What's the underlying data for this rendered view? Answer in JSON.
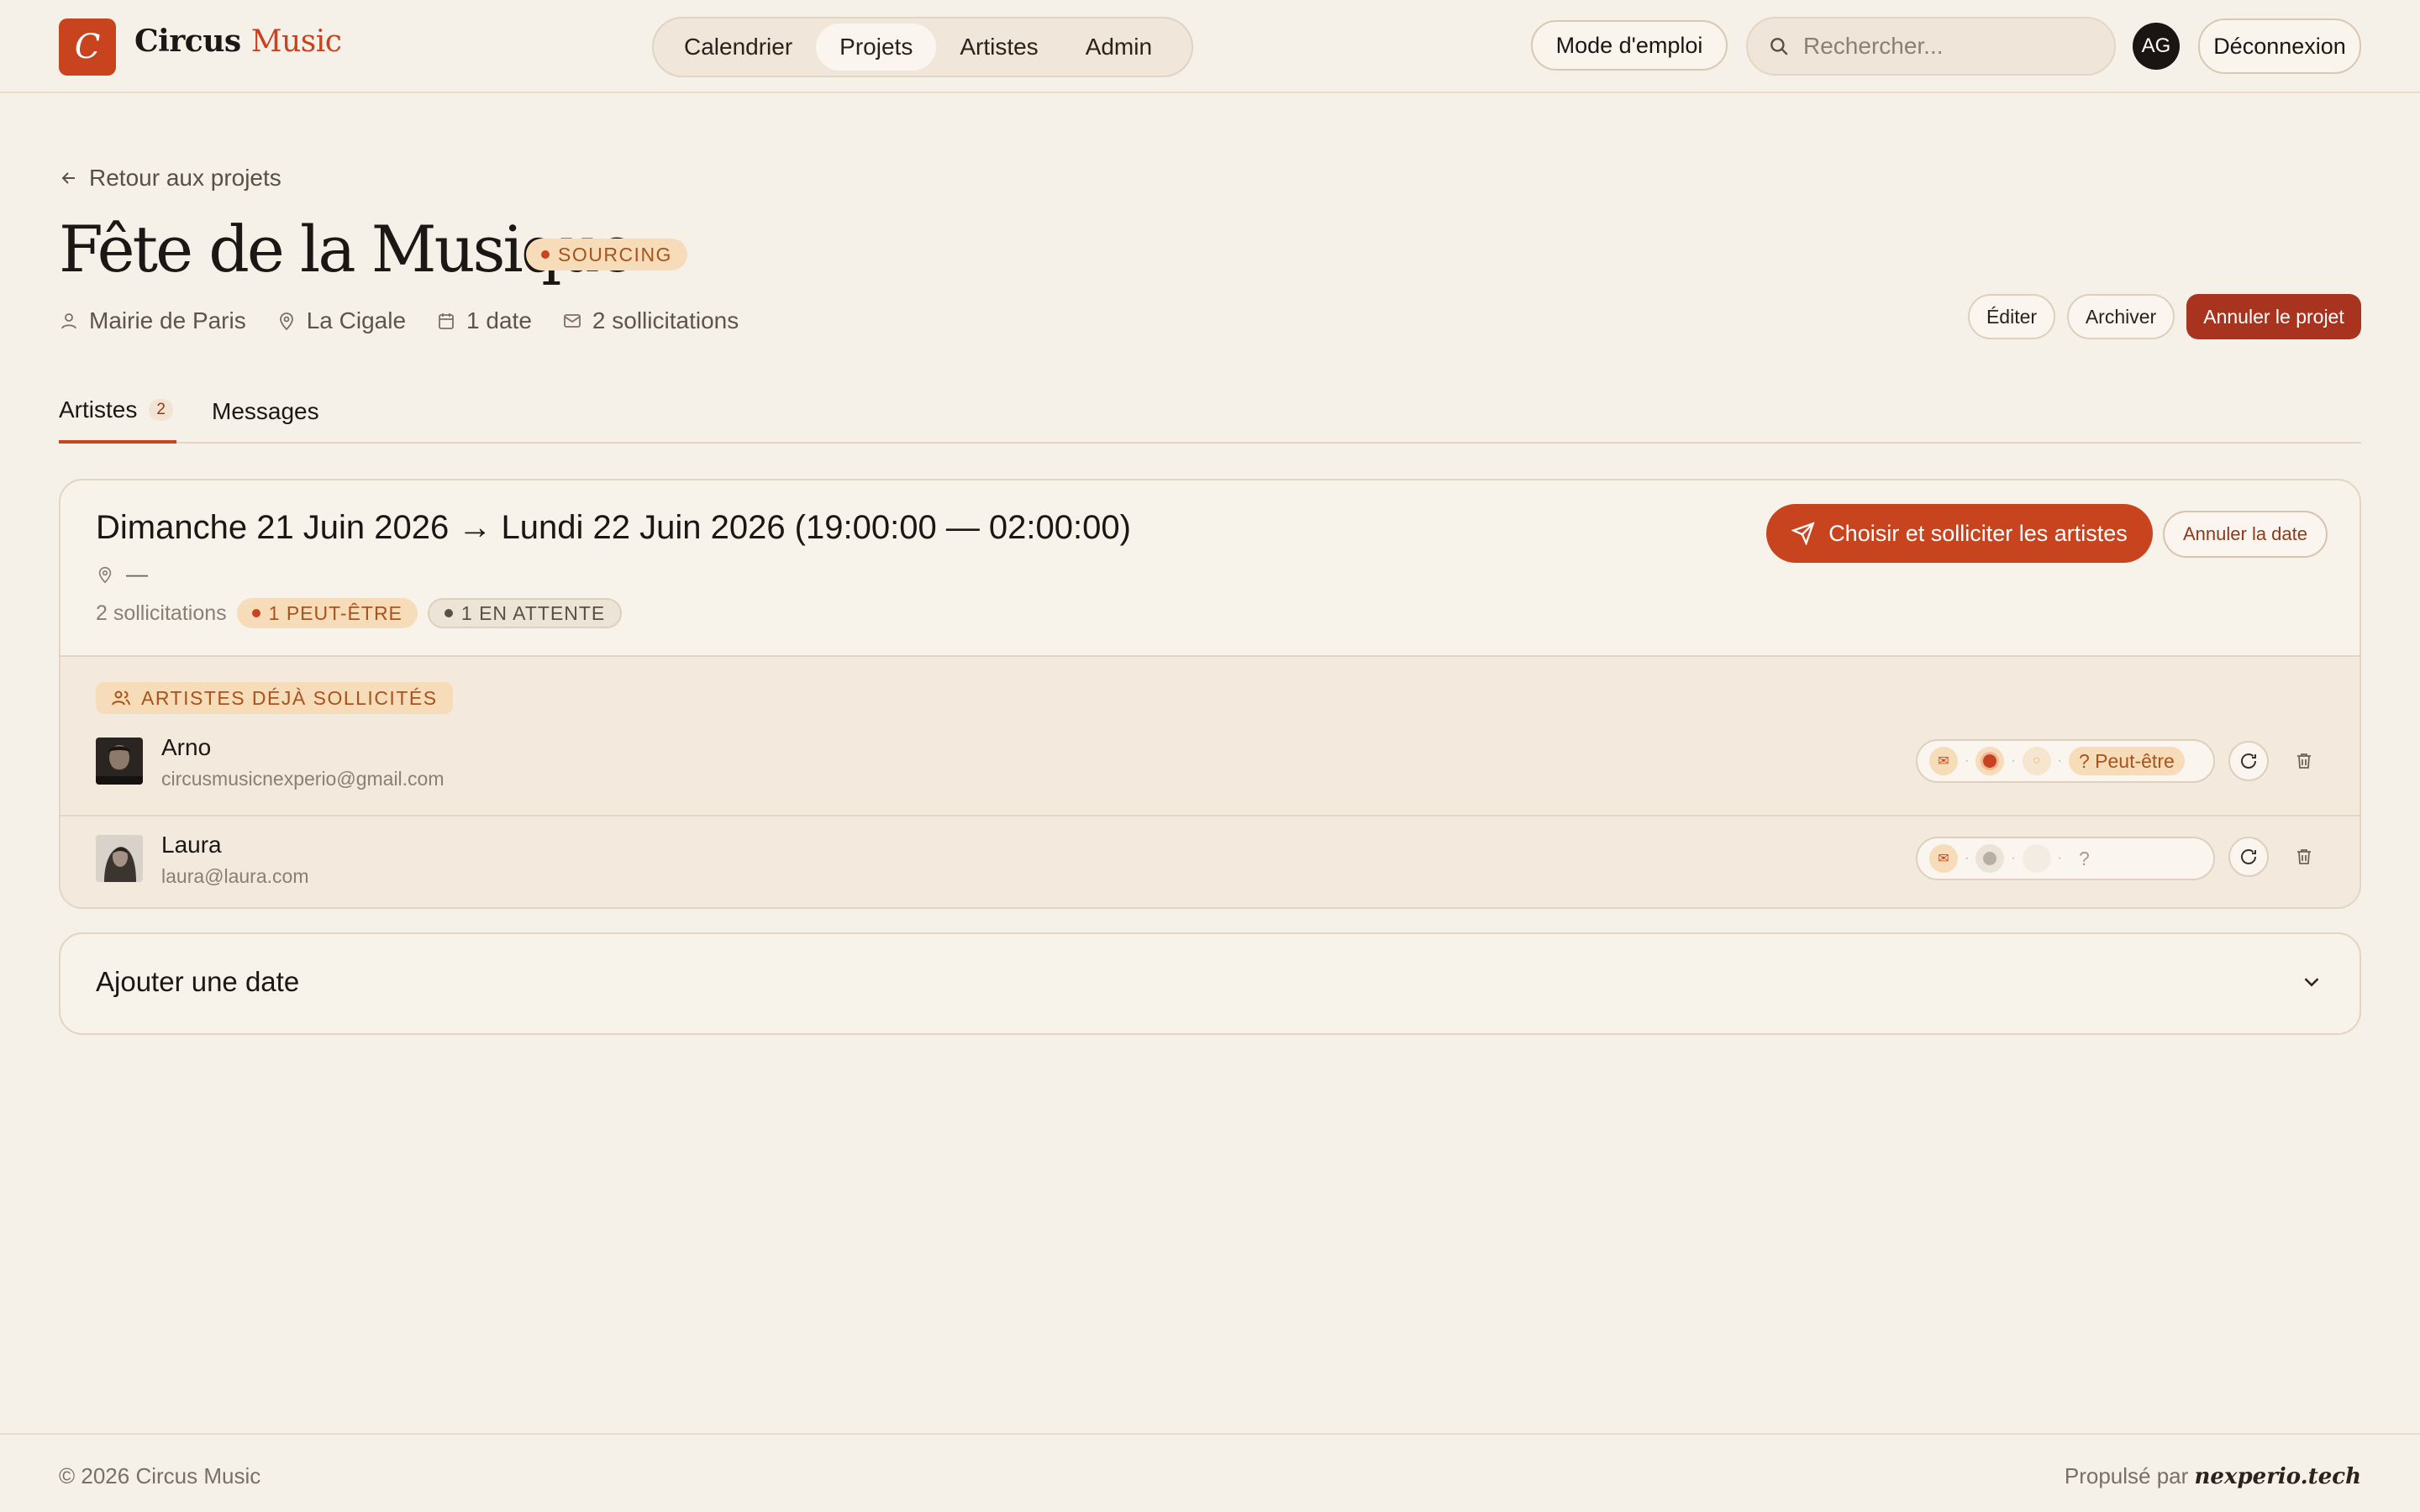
{
  "brand": {
    "initial": "C",
    "name_part1": "Circus",
    "name_part2": "Music"
  },
  "nav": {
    "items": [
      "Calendrier",
      "Projets",
      "Artistes",
      "Admin"
    ],
    "active": "Projets"
  },
  "header": {
    "help_label": "Mode d'emploi",
    "search_placeholder": "Rechercher...",
    "user_initials": "AG",
    "logout_label": "Déconnexion"
  },
  "project": {
    "back_label": "Retour aux projets",
    "title": "Fête de la Musique",
    "status": "SOURCING",
    "client": "Mairie de Paris",
    "venue": "La Cigale",
    "dates_count": "1 date",
    "solicitations_count": "2 sollicitations",
    "actions": {
      "edit": "Éditer",
      "archive": "Archiver",
      "cancel": "Annuler le projet"
    }
  },
  "tabs": {
    "artists_label": "Artistes",
    "artists_count": "2",
    "messages_label": "Messages"
  },
  "date_card": {
    "title": "Dimanche 21 Juin 2026 → Lundi 22 Juin 2026 (19:00:00 — 02:00:00)",
    "location": "—",
    "stats_label": "2 sollicitations",
    "pill_maybe": "1 PEUT-ÊTRE",
    "pill_waiting": "1 EN ATTENTE",
    "solicit_button": "Choisir et solliciter les artistes",
    "cancel_date_button": "Annuler la date",
    "section_label": "ARTISTES DÉJÀ SOLLICITÉS",
    "artists": [
      {
        "name": "Arno",
        "email": "circusmusicnexperio@gmail.com",
        "status_label": "? Peut-être"
      },
      {
        "name": "Laura",
        "email": "laura@laura.com",
        "status_label": "?"
      }
    ]
  },
  "add_date": {
    "label": "Ajouter une date"
  },
  "footer": {
    "copyright": "© 2026 Circus Music",
    "powered_prefix": "Propulsé par",
    "powered_brand": "nexperio.tech"
  },
  "colors": {
    "accent": "#c8441f",
    "danger": "#a8341f",
    "background": "#f5f0e8",
    "badge_bg": "#f6dcb8"
  }
}
